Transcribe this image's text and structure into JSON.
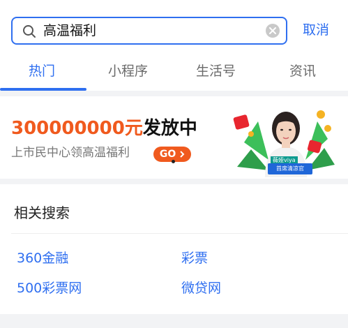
{
  "search": {
    "query": "高温福利",
    "cancel_label": "取消"
  },
  "tabs": [
    {
      "label": "热门",
      "active": true
    },
    {
      "label": "小程序",
      "active": false
    },
    {
      "label": "生活号",
      "active": false
    },
    {
      "label": "资讯",
      "active": false
    }
  ],
  "banner": {
    "amount": "300000000元",
    "suffix": "发放中",
    "subtitle": "上市民中心领高温福利",
    "go_label": "GO",
    "promo_caption": "首席清凉官",
    "promo_tag": "薇娅viya"
  },
  "related": {
    "title": "相关搜索",
    "links": [
      "360金融",
      "彩票",
      "500彩票网",
      "微贷网"
    ]
  },
  "colors": {
    "accent": "#2f6ff0",
    "highlight": "#f05a1e"
  },
  "icons": [
    "search-icon",
    "clear-icon",
    "chevron-right-icon",
    "red-envelope-icon",
    "gold-coin-icon"
  ]
}
